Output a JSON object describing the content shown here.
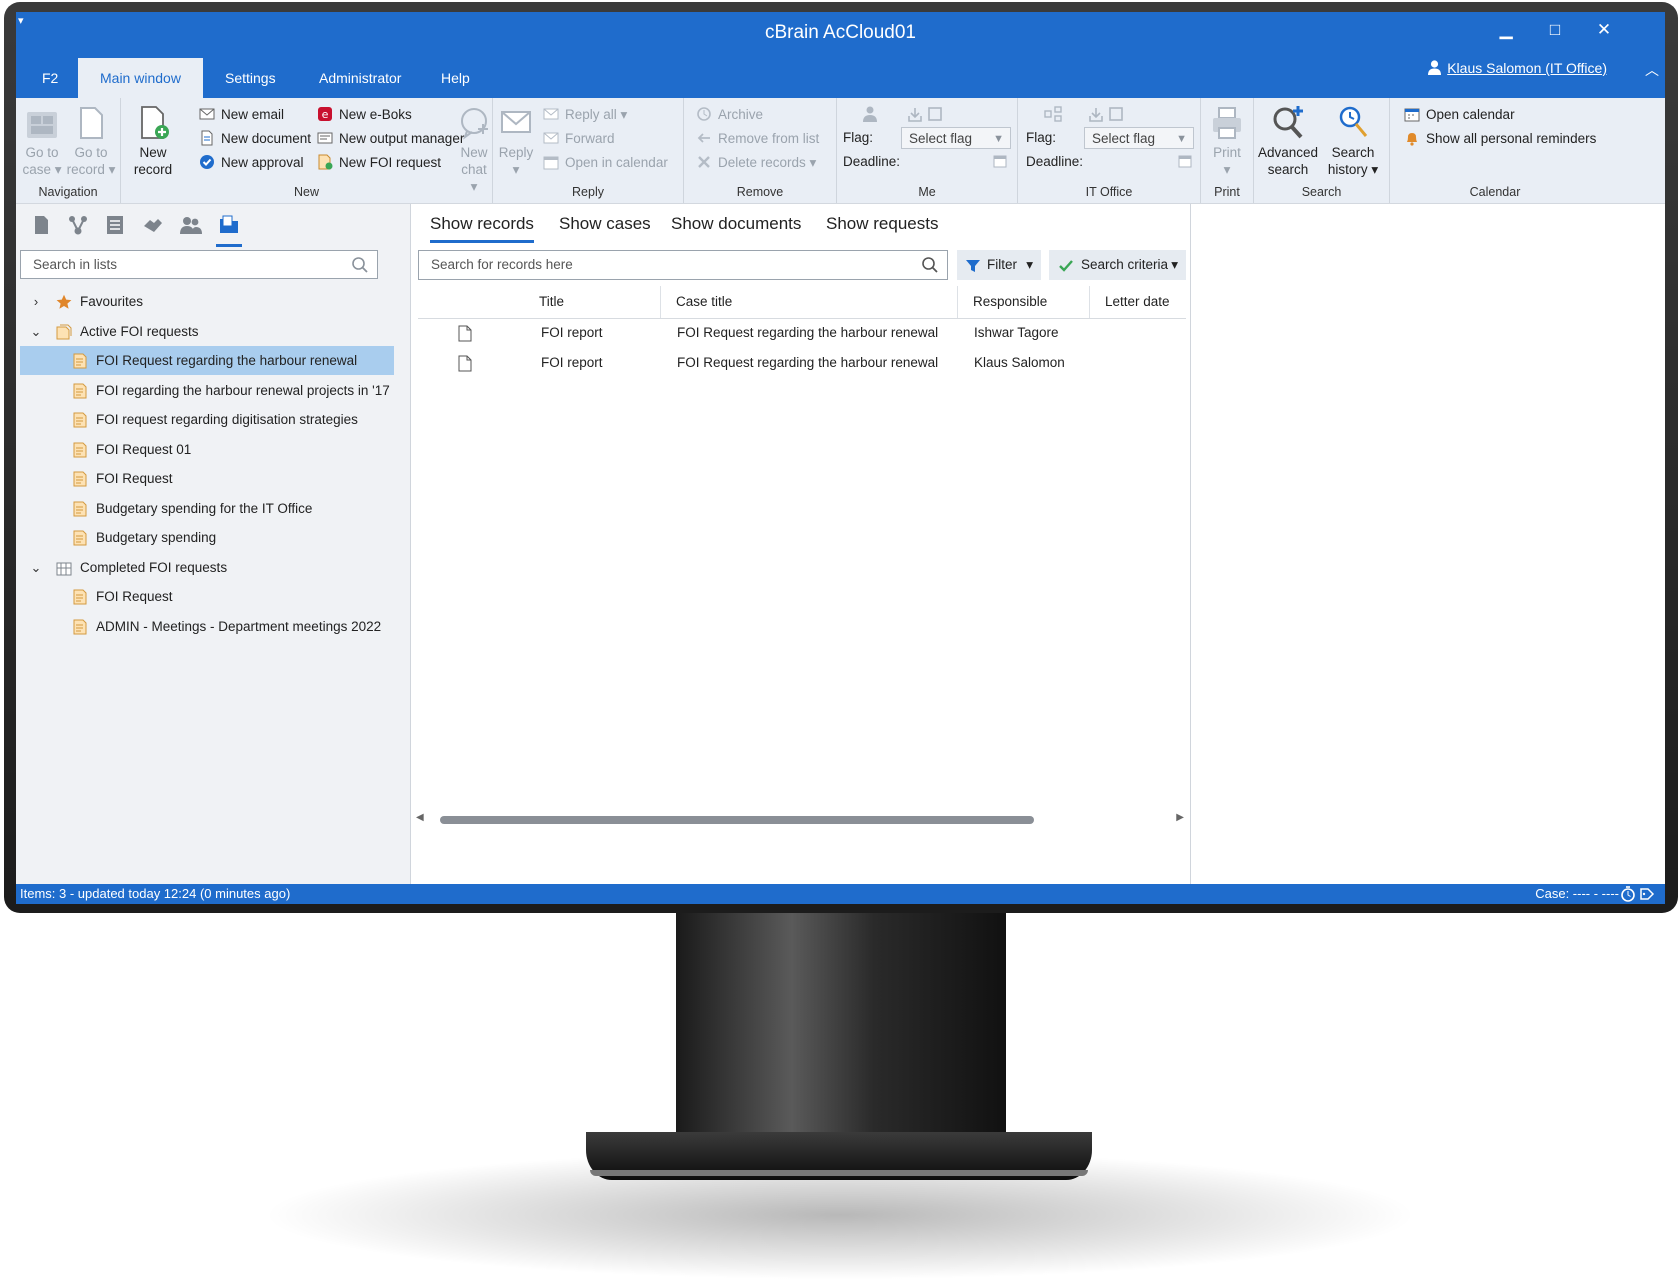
{
  "window": {
    "title": "cBrain AcCloud01",
    "sys_menu_glyph": "▾",
    "minimize": "▁",
    "maximize": "□",
    "close": "✕",
    "collapse": "︿"
  },
  "menu": {
    "tabs": [
      {
        "label": "F2"
      },
      {
        "label": "Main window"
      },
      {
        "label": "Settings"
      },
      {
        "label": "Administrator"
      },
      {
        "label": "Help"
      }
    ],
    "active_tab": "Main window",
    "user": "Klaus Salomon (IT Office)"
  },
  "ribbon": {
    "navigation": {
      "label": "Navigation",
      "go_to_case": [
        "Go to",
        "case ▾"
      ],
      "go_to_record": [
        "Go to",
        "record ▾"
      ]
    },
    "new": {
      "label": "New",
      "new_record": [
        "New",
        "record"
      ],
      "items": [
        "New email",
        "New document",
        "New approval",
        "New e-Boks",
        "New output manager",
        "New FOI request"
      ],
      "new_chat": [
        "New",
        "chat ▾"
      ]
    },
    "reply": {
      "label": "Reply",
      "reply": [
        "Reply",
        "▾"
      ],
      "items": [
        "Reply all ▾",
        "Forward",
        "Open in calendar"
      ]
    },
    "remove": {
      "label": "Remove",
      "items": [
        "Archive",
        "Remove from list",
        "Delete records ▾"
      ]
    },
    "me": {
      "label": "Me",
      "flag_label": "Flag:",
      "deadline_label": "Deadline:",
      "flag_placeholder": "Select flag"
    },
    "it_office": {
      "label": "IT Office",
      "flag_label": "Flag:",
      "deadline_label": "Deadline:",
      "flag_placeholder": "Select flag"
    },
    "print": {
      "label": "Print",
      "print": [
        "Print",
        "▾"
      ]
    },
    "search": {
      "label": "Search",
      "advanced": [
        "Advanced",
        "search"
      ],
      "history": [
        "Search",
        "history ▾"
      ]
    },
    "calendar": {
      "label": "Calendar",
      "items": [
        "Open calendar",
        "Show all personal reminders"
      ]
    }
  },
  "left_pane": {
    "icons": [
      "document-icon",
      "case-tree-icon",
      "list-icon",
      "handshake-icon",
      "people-icon",
      "folder-icon"
    ],
    "search_placeholder": "Search in lists",
    "tree": [
      {
        "label": "Favourites",
        "level": 0,
        "chevron": "›",
        "icon": "star-icon"
      },
      {
        "label": "Active FOI requests",
        "level": 0,
        "chevron": "⌄",
        "icon": "foi-group-icon"
      },
      {
        "label": "FOI Request regarding the harbour renewal",
        "level": 1,
        "icon": "foi-icon",
        "selected": true
      },
      {
        "label": "FOI regarding the harbour renewal projects in '17",
        "level": 1,
        "icon": "foi-icon"
      },
      {
        "label": "FOI request regarding digitisation strategies",
        "level": 1,
        "icon": "foi-icon"
      },
      {
        "label": "FOI Request 01",
        "level": 1,
        "icon": "foi-icon"
      },
      {
        "label": "FOI Request",
        "level": 1,
        "icon": "foi-icon"
      },
      {
        "label": "Budgetary spending for the IT Office",
        "level": 1,
        "icon": "foi-icon"
      },
      {
        "label": "Budgetary spending",
        "level": 1,
        "icon": "foi-icon"
      },
      {
        "label": "Completed FOI requests",
        "level": 0,
        "chevron": "⌄",
        "icon": "archive-group-icon"
      },
      {
        "label": "FOI Request",
        "level": 1,
        "icon": "foi-icon"
      },
      {
        "label": "ADMIN - Meetings - Department meetings 2022",
        "level": 1,
        "icon": "foi-icon"
      }
    ]
  },
  "main": {
    "tabs": [
      "Show records",
      "Show cases",
      "Show documents",
      "Show requests"
    ],
    "active_tab": "Show records",
    "search_placeholder": "Search for records here",
    "filter_label": "Filter",
    "criteria_label": "Search criteria",
    "dropdown_glyph": "▾",
    "columns": [
      "Title",
      "Case title",
      "Responsible",
      "Letter date"
    ],
    "rows": [
      {
        "title": "FOI report",
        "case_title": "FOI Request regarding the harbour renewal",
        "responsible": "Ishwar Tagore",
        "letter_date": ""
      },
      {
        "title": "FOI report",
        "case_title": "FOI Request regarding the harbour renewal",
        "responsible": "Klaus Salomon",
        "letter_date": ""
      }
    ],
    "scroll_left": "◀",
    "scroll_right": "▶"
  },
  "status": {
    "left": "Items: 3 - updated today 12:24 (0 minutes ago)",
    "right": "Case: ---- - ----"
  },
  "colors": {
    "accent": "#1f6ccc",
    "ribbon_bg": "#e9eef5",
    "selection": "#a9cdee",
    "foi_folder": "#f2b35a"
  }
}
